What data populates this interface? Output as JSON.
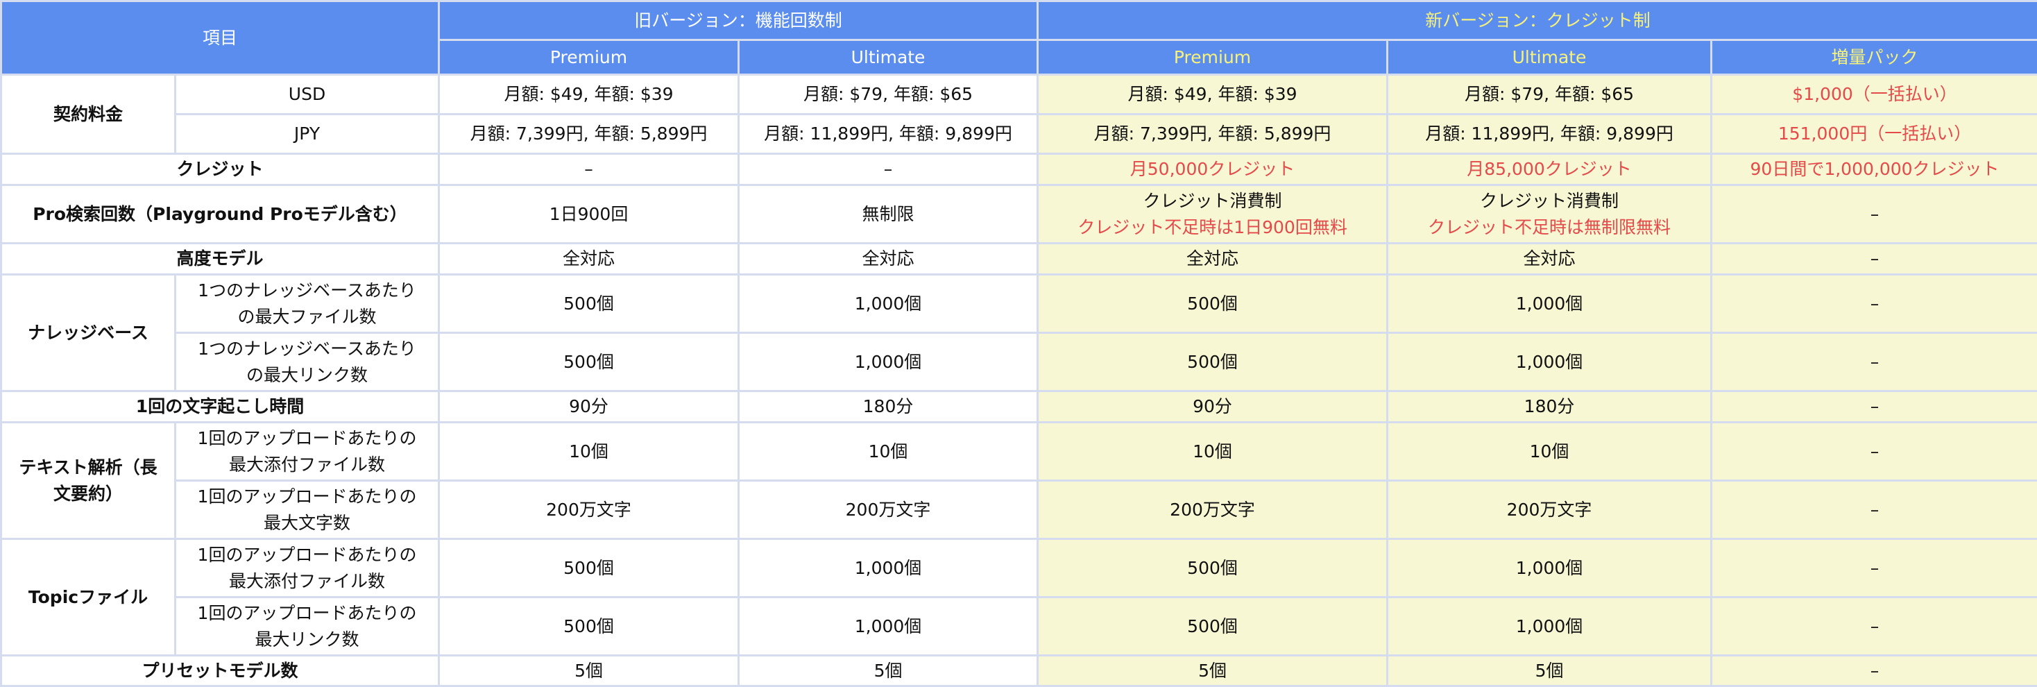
{
  "header": {
    "item": "項目",
    "old_group": "旧バージョン：機能回数制",
    "new_group": "新バージョン：クレジット制",
    "old_premium": "Premium",
    "old_ultimate": "Ultimate",
    "new_premium": "Premium",
    "new_ultimate": "Ultimate",
    "new_pack": "増量パック"
  },
  "rows": {
    "contract": {
      "label": "契約料金",
      "usd": {
        "sub": "USD",
        "old_premium": "月額: $49, 年額: $39",
        "old_ultimate": "月額: $79, 年額: $65",
        "new_premium": "月額: $49, 年額: $39",
        "new_ultimate": "月額: $79, 年額: $65",
        "new_pack": "$1,000（一括払い）"
      },
      "jpy": {
        "sub": "JPY",
        "old_premium": "月額: 7,399円, 年額: 5,899円",
        "old_ultimate": "月額: 11,899円, 年額: 9,899円",
        "new_premium": "月額: 7,399円, 年額: 5,899円",
        "new_ultimate": "月額: 11,899円, 年額: 9,899円",
        "new_pack": "151,000円（一括払い）"
      }
    },
    "credit": {
      "label": "クレジット",
      "old_premium": "–",
      "old_ultimate": "–",
      "new_premium": "月50,000クレジット",
      "new_ultimate": "月85,000クレジット",
      "new_pack": "90日間で1,000,000クレジット"
    },
    "pro_search": {
      "label": "Pro検索回数（Playground Proモデル含む）",
      "old_premium": "1日900回",
      "old_ultimate": "無制限",
      "new_premium_line1": "クレジット消費制",
      "new_premium_line2": "クレジット不足時は1日900回無料",
      "new_ultimate_line1": "クレジット消費制",
      "new_ultimate_line2": "クレジット不足時は無制限無料",
      "new_pack": "–"
    },
    "advanced_model": {
      "label": "高度モデル",
      "old_premium": "全対応",
      "old_ultimate": "全対応",
      "new_premium": "全対応",
      "new_ultimate": "全対応",
      "new_pack": "–"
    },
    "knowledge_base": {
      "label": "ナレッジベース",
      "files": {
        "sub_line1": "1つのナレッジベースあたり",
        "sub_line2": "の最大ファイル数",
        "old_premium": "500個",
        "old_ultimate": "1,000個",
        "new_premium": "500個",
        "new_ultimate": "1,000個",
        "new_pack": "–"
      },
      "links": {
        "sub_line1": "1つのナレッジベースあたり",
        "sub_line2": "の最大リンク数",
        "old_premium": "500個",
        "old_ultimate": "1,000個",
        "new_premium": "500個",
        "new_ultimate": "1,000個",
        "new_pack": "–"
      }
    },
    "transcription": {
      "label": "1回の文字起こし時間",
      "old_premium": "90分",
      "old_ultimate": "180分",
      "new_premium": "90分",
      "new_ultimate": "180分",
      "new_pack": "–"
    },
    "text_analysis": {
      "label_line1": "テキスト解析（長",
      "label_line2": "文要約）",
      "attachments": {
        "sub_line1": "1回のアップロードあたりの",
        "sub_line2": "最大添付ファイル数",
        "old_premium": "10個",
        "old_ultimate": "10個",
        "new_premium": "10個",
        "new_ultimate": "10個",
        "new_pack": "–"
      },
      "chars": {
        "sub_line1": "1回のアップロードあたりの",
        "sub_line2": "最大文字数",
        "old_premium": "200万文字",
        "old_ultimate": "200万文字",
        "new_premium": "200万文字",
        "new_ultimate": "200万文字",
        "new_pack": "–"
      }
    },
    "topic_file": {
      "label": "Topicファイル",
      "attachments": {
        "sub_line1": "1回のアップロードあたりの",
        "sub_line2": "最大添付ファイル数",
        "old_premium": "500個",
        "old_ultimate": "1,000個",
        "new_premium": "500個",
        "new_ultimate": "1,000個",
        "new_pack": "–"
      },
      "links": {
        "sub_line1": "1回のアップロードあたりの",
        "sub_line2": "最大リンク数",
        "old_premium": "500個",
        "old_ultimate": "1,000個",
        "new_premium": "500個",
        "new_ultimate": "1,000個",
        "new_pack": "–"
      }
    },
    "preset_models": {
      "label": "プリセットモデル数",
      "old_premium": "5個",
      "old_ultimate": "5個",
      "new_premium": "5個",
      "new_ultimate": "5個",
      "new_pack": "–"
    }
  },
  "colors": {
    "header_bg": "#5b8def",
    "header_yellow": "#f8f27a",
    "new_bg": "#f7f7d4",
    "accent_red": "#e44a4a",
    "grid": "#d6dcef"
  }
}
